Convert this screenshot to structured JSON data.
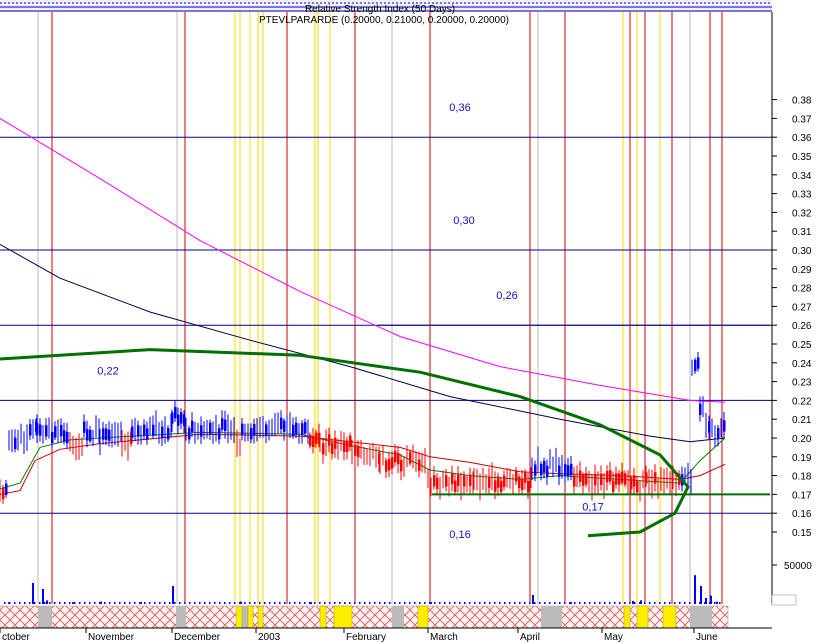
{
  "header": {
    "indicator_label": "Relative Strength Index (50 Days)",
    "ticker_line": "PTEVLPARARDE (0.20000, 0.21000, 0.20000, 0.20000)"
  },
  "colors": {
    "bull": "#0000ff",
    "bear": "#ff0000",
    "ma_long": "#ff00ff",
    "ma_mid": "#00004a",
    "ma_short_red": "#cc0000",
    "ma_short_green": "#008000",
    "arc": "#007000",
    "level_line": "#00008b",
    "event_red": "#cc0000",
    "event_yellow": "#ffd700",
    "week_grey": "#bbbbbb"
  },
  "chart_data": {
    "type": "candlestick",
    "y_axis_ticks": [
      "0.38",
      "0.37",
      "0.36",
      "0.35",
      "0.34",
      "0.33",
      "0.32",
      "0.31",
      "0.30",
      "0.29",
      "0.28",
      "0.27",
      "0.26",
      "0.25",
      "0.24",
      "0.23",
      "0.22",
      "0.21",
      "0.20",
      "0.19",
      "0.18",
      "0.17",
      "0.16",
      "0.15"
    ],
    "ylim": [
      0.145,
      0.39
    ],
    "volume_axis_label": "50000",
    "volume_axis_ticks": [
      "50000"
    ],
    "x_axis_labels": [
      "ctober",
      "November",
      "December",
      "2003",
      "February",
      "March",
      "April",
      "May",
      "June"
    ],
    "horizontal_levels": [
      {
        "label": "0,36",
        "value": 0.36
      },
      {
        "label": "0,30",
        "value": 0.3
      },
      {
        "label": "0,26",
        "value": 0.26
      },
      {
        "label": "0,22",
        "value": 0.22
      },
      {
        "label": "0,17",
        "value": 0.17
      },
      {
        "label": "0,16",
        "value": 0.16
      }
    ],
    "price_segments": [
      {
        "from": 0,
        "to": 6,
        "value": 0.168,
        "color": "bear"
      },
      {
        "from": 6,
        "to": 9,
        "value": 0.172,
        "color": "bull"
      },
      {
        "from": 9,
        "to": 30,
        "value": 0.2,
        "color": "bull"
      },
      {
        "from": 30,
        "to": 37,
        "value": 0.205,
        "color": "bull"
      },
      {
        "from": 37,
        "to": 70,
        "value": 0.203,
        "color": "bull"
      },
      {
        "from": 70,
        "to": 84,
        "value": 0.197,
        "color": "bear"
      },
      {
        "from": 84,
        "to": 100,
        "value": 0.203,
        "color": "bull"
      },
      {
        "from": 100,
        "to": 122,
        "value": 0.2,
        "color": "bull"
      },
      {
        "from": 122,
        "to": 132,
        "value": 0.197,
        "color": "bear"
      },
      {
        "from": 132,
        "to": 172,
        "value": 0.205,
        "color": "bull"
      },
      {
        "from": 172,
        "to": 186,
        "value": 0.212,
        "color": "bull"
      },
      {
        "from": 186,
        "to": 237,
        "value": 0.205,
        "color": "bull"
      },
      {
        "from": 237,
        "to": 242,
        "value": 0.197,
        "color": "bear"
      },
      {
        "from": 242,
        "to": 310,
        "value": 0.205,
        "color": "bull"
      },
      {
        "from": 310,
        "to": 320,
        "value": 0.197,
        "color": "bear"
      },
      {
        "from": 320,
        "to": 352,
        "value": 0.197,
        "color": "bear"
      },
      {
        "from": 352,
        "to": 380,
        "value": 0.192,
        "color": "bear"
      },
      {
        "from": 380,
        "to": 428,
        "value": 0.188,
        "color": "bear"
      },
      {
        "from": 428,
        "to": 474,
        "value": 0.177,
        "color": "bear"
      },
      {
        "from": 474,
        "to": 532,
        "value": 0.177,
        "color": "bear"
      },
      {
        "from": 532,
        "to": 574,
        "value": 0.185,
        "color": "bull"
      },
      {
        "from": 574,
        "to": 640,
        "value": 0.177,
        "color": "bear"
      },
      {
        "from": 640,
        "to": 682,
        "value": 0.176,
        "color": "bear"
      },
      {
        "from": 682,
        "to": 692,
        "value": 0.18,
        "color": "bull"
      },
      {
        "from": 692,
        "to": 700,
        "value": 0.24,
        "color": "bull"
      },
      {
        "from": 700,
        "to": 706,
        "value": 0.215,
        "color": "bull"
      },
      {
        "from": 706,
        "to": 726,
        "value": 0.205,
        "color": "bull"
      }
    ],
    "series": [
      {
        "key": "ma_long",
        "points": [
          [
            0,
            0.37
          ],
          [
            100,
            0.338
          ],
          [
            200,
            0.305
          ],
          [
            300,
            0.278
          ],
          [
            400,
            0.254
          ],
          [
            500,
            0.238
          ],
          [
            600,
            0.228
          ],
          [
            690,
            0.22
          ],
          [
            725,
            0.219
          ]
        ]
      },
      {
        "key": "ma_mid",
        "points": [
          [
            0,
            0.303
          ],
          [
            60,
            0.285
          ],
          [
            150,
            0.267
          ],
          [
            250,
            0.252
          ],
          [
            350,
            0.238
          ],
          [
            450,
            0.222
          ],
          [
            560,
            0.21
          ],
          [
            650,
            0.201
          ],
          [
            690,
            0.198
          ],
          [
            725,
            0.2
          ]
        ]
      },
      {
        "key": "ma_short_red",
        "points": [
          [
            0,
            0.17
          ],
          [
            20,
            0.172
          ],
          [
            35,
            0.188
          ],
          [
            60,
            0.194
          ],
          [
            100,
            0.197
          ],
          [
            200,
            0.202
          ],
          [
            300,
            0.201
          ],
          [
            350,
            0.198
          ],
          [
            400,
            0.195
          ],
          [
            430,
            0.19
          ],
          [
            470,
            0.187
          ],
          [
            520,
            0.182
          ],
          [
            560,
            0.181
          ],
          [
            620,
            0.18
          ],
          [
            680,
            0.178
          ],
          [
            700,
            0.18
          ],
          [
            725,
            0.186
          ]
        ]
      },
      {
        "key": "ma_short_green",
        "points": [
          [
            0,
            0.173
          ],
          [
            20,
            0.176
          ],
          [
            40,
            0.195
          ],
          [
            70,
            0.199
          ],
          [
            100,
            0.2
          ],
          [
            200,
            0.203
          ],
          [
            300,
            0.202
          ],
          [
            350,
            0.196
          ],
          [
            400,
            0.191
          ],
          [
            430,
            0.183
          ],
          [
            470,
            0.18
          ],
          [
            520,
            0.178
          ],
          [
            560,
            0.18
          ],
          [
            620,
            0.178
          ],
          [
            680,
            0.176
          ],
          [
            700,
            0.188
          ],
          [
            725,
            0.2
          ]
        ]
      }
    ],
    "arc_curve": [
      [
        0,
        0.242
      ],
      [
        150,
        0.247
      ],
      [
        300,
        0.244
      ],
      [
        420,
        0.235
      ],
      [
        520,
        0.222
      ],
      [
        600,
        0.207
      ],
      [
        660,
        0.191
      ],
      [
        688,
        0.174
      ],
      [
        675,
        0.16
      ],
      [
        640,
        0.15
      ],
      [
        588,
        0.148
      ]
    ],
    "fib_overlay": {
      "from_x": 378,
      "to_x": 770,
      "value": 0.26
    },
    "support_line": {
      "from_x": 432,
      "to_x": 770,
      "value": 0.17
    },
    "event_lines_red": [
      52,
      185,
      287,
      355,
      430,
      530,
      565,
      630,
      645,
      672,
      710,
      722
    ],
    "event_lines_yellow": [
      235,
      240,
      250,
      258,
      263,
      315,
      318,
      330,
      623,
      637,
      660
    ],
    "week_markers": [
      38,
      177,
      392,
      538,
      690
    ],
    "volume_bars": [
      [
        8,
        3
      ],
      [
        32,
        35
      ],
      [
        42,
        25
      ],
      [
        46,
        6
      ],
      [
        72,
        3
      ],
      [
        100,
        4
      ],
      [
        140,
        3
      ],
      [
        172,
        30
      ],
      [
        240,
        4
      ],
      [
        310,
        3
      ],
      [
        430,
        3
      ],
      [
        532,
        15
      ],
      [
        570,
        3
      ],
      [
        632,
        5
      ],
      [
        640,
        6
      ],
      [
        694,
        48
      ],
      [
        700,
        30
      ],
      [
        705,
        10
      ],
      [
        710,
        14
      ],
      [
        716,
        4
      ]
    ],
    "calendar_yellow": [
      [
        236,
        242
      ],
      [
        248,
        253
      ],
      [
        258,
        263
      ],
      [
        320,
        326
      ],
      [
        334,
        352
      ],
      [
        418,
        428
      ],
      [
        624,
        630
      ],
      [
        637,
        648
      ],
      [
        663,
        676
      ]
    ],
    "calendar_grey": [
      [
        38,
        52
      ],
      [
        176,
        186
      ],
      [
        240,
        248
      ],
      [
        392,
        404
      ],
      [
        541,
        562
      ],
      [
        690,
        712
      ]
    ]
  }
}
